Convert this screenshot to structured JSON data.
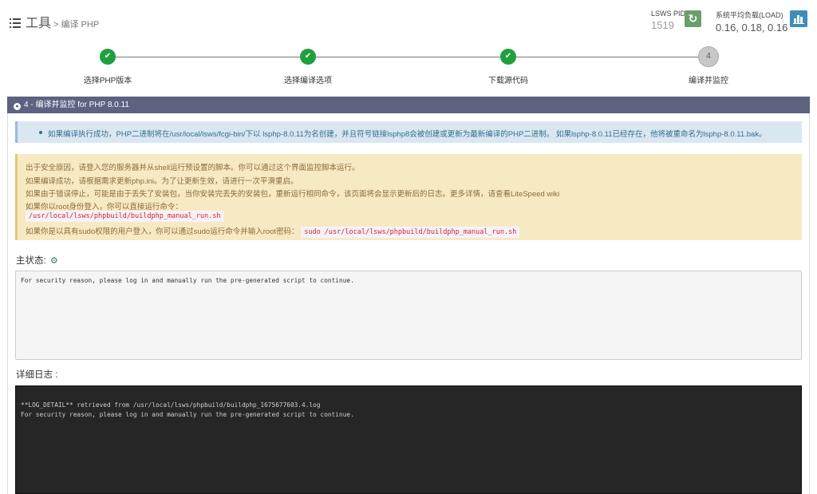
{
  "header": {
    "title": "工具",
    "subtitle": "> 编译 PHP",
    "pid_label": "LSWS PID",
    "pid_value": "1519",
    "load_label": "系统平均负载(LOAD)",
    "load_value": "0.16, 0.18, 0.16",
    "icons": {
      "menu": "list-icon",
      "reload": "refresh-icon",
      "chart": "bar-chart-icon"
    },
    "colors": {
      "reload": "#6a9f6a",
      "chart": "#3c8dbc"
    }
  },
  "steps": [
    {
      "label": "选择PHP版本",
      "status": "done"
    },
    {
      "label": "选择编译选项",
      "status": "done"
    },
    {
      "label": "下载源代码",
      "status": "done"
    },
    {
      "label": "编译并监控",
      "status": "active",
      "number": "4"
    }
  ],
  "section": {
    "title": "4 - 编译并监控 for PHP 8.0.11",
    "info": "如果编译执行成功，PHP二进制将在/usr/local/lsws/fcgi-bin/下以 lsphp-8.0.11为名创建，并且符号链接lsphp8会被创建或更新为最新编译的PHP二进制。 如果lsphp-8.0.11已经存在，他将被重命名为lsphp-8.0.11.bak。",
    "warning": {
      "line1": "出于安全原因，请登入您的服务器并从shell运行预设置的脚本。你可以通过这个界面监控脚本运行。",
      "line2": "如果编译成功，请根据需求更新php.ini。为了让更新生效，请进行一次平滑重启。",
      "line3": "如果由于错误停止，可能是由于丢失了安装包，当你安装完丢失的安装包，重新运行相同命令，该页面将会显示更新后的日志。更多详情，请查看LiteSpeed wiki",
      "line4": "如果你以root身份登入，你可以直接运行命令：",
      "root_cmd": "/usr/local/lsws/phpbuild/buildphp_manual_run.sh",
      "line6": "如果你是以具有sudo权限的用户登入，你可以通过sudo运行命令并输入root密码：",
      "sudo_cmd": "sudo /usr/local/lsws/phpbuild/buildphp_manual_run.sh"
    },
    "status_title": "主状态:",
    "status_text": "For security reason, please log in and manually run the pre-generated script to continue.",
    "log_title": "详细日志 :",
    "log_lines": [
      "**LOG_DETAIL** retrieved from /usr/local/lsws/phpbuild/buildphp_1675677603.4.log",
      "For security reason, please log in and manually run the pre-generated script to continue."
    ]
  }
}
